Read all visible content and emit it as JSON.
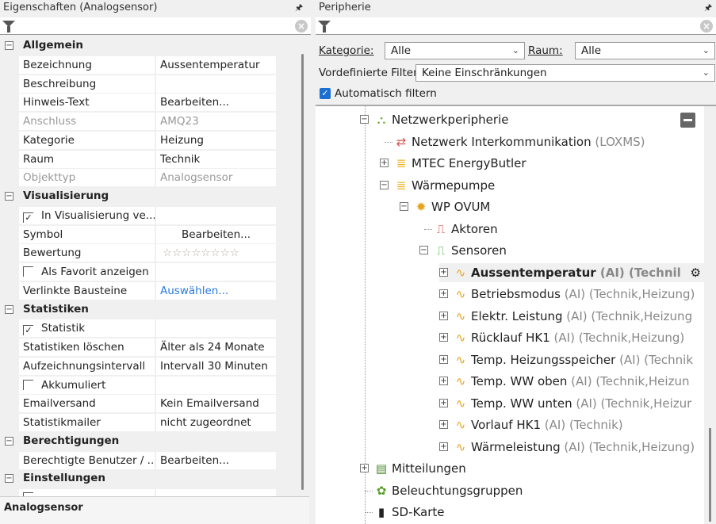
{
  "left": {
    "title": "Eigenschaften (Analogsensor)",
    "pin": "ꟷ",
    "status": "Analogsensor",
    "rows": [
      {
        "type": "section",
        "label": "Allgemein"
      },
      {
        "label": "Bezeichnung",
        "value": "Aussentemperatur"
      },
      {
        "label": "Beschreibung",
        "value": ""
      },
      {
        "label": "Hinweis-Text",
        "value": "Bearbeiten..."
      },
      {
        "label": "Anschluss",
        "value": "AMQ23",
        "disabled": true
      },
      {
        "label": "Kategorie",
        "value": "Heizung"
      },
      {
        "label": "Raum",
        "value": "Technik"
      },
      {
        "label": "Objekttyp",
        "value": "Analogsensor",
        "disabled": true
      },
      {
        "type": "section",
        "label": "Visualisierung"
      },
      {
        "type": "check",
        "label": "In Visualisierung ve...",
        "checked": true
      },
      {
        "label": "Symbol",
        "value": "Bearbeiten...",
        "center": true
      },
      {
        "label": "Bewertung",
        "value": "☆☆☆☆☆☆☆☆",
        "stars": true
      },
      {
        "type": "check",
        "label": "Als Favorit anzeigen",
        "checked": false
      },
      {
        "label": "Verlinkte Bausteine",
        "value": "Auswählen...",
        "link": true
      },
      {
        "type": "section",
        "label": "Statistiken"
      },
      {
        "type": "check",
        "label": "Statistik",
        "checked": true
      },
      {
        "label": "Statistiken löschen",
        "value": "Älter als 24 Monate"
      },
      {
        "label": "Aufzeichnungsintervall",
        "value": "Intervall 30 Minuten"
      },
      {
        "type": "check",
        "label": "Akkumuliert",
        "checked": false
      },
      {
        "label": "Emailversand",
        "value": "Kein Emailversand"
      },
      {
        "label": "Statistikmailer",
        "value": "nicht zugeordnet"
      },
      {
        "type": "section",
        "label": "Berechtigungen"
      },
      {
        "label": "Berechtigte Benutzer / ...",
        "value": "Bearbeiten..."
      },
      {
        "type": "section",
        "label": "Einstellungen"
      },
      {
        "type": "check",
        "label": "",
        "checked": false
      }
    ]
  },
  "right": {
    "title": "Peripherie",
    "kategorie_label": "Kategorie:",
    "kategorie_value": "Alle",
    "raum_label": "Raum:",
    "raum_value": "Alle",
    "filter_label": "Vordefinierte Filter",
    "filter_value": "Keine Einschränkungen",
    "auto_filter_label": "Automatisch filtern",
    "auto_filter_checked": true,
    "tree": [
      {
        "level": 0,
        "exp": "-",
        "icon": "network-icon",
        "glyph": "⛬",
        "color": "#6ab023",
        "label": "Netzwerkperipherie",
        "suffix": ""
      },
      {
        "level": 1,
        "exp": "",
        "icon": "intercom-icon",
        "glyph": "⇄",
        "color": "#d9534f",
        "label": "Netzwerk Interkommunikation",
        "suffix": "(LOXMS)"
      },
      {
        "level": 1,
        "exp": "+",
        "icon": "database-icon",
        "glyph": "≣",
        "color": "#f0b429",
        "label": "MTEC EnergyButler",
        "suffix": ""
      },
      {
        "level": 1,
        "exp": "-",
        "icon": "database-icon",
        "glyph": "≣",
        "color": "#f0b429",
        "label": "Wärmepumpe",
        "suffix": ""
      },
      {
        "level": 2,
        "exp": "-",
        "icon": "device-icon",
        "glyph": "✹",
        "color": "#e8a317",
        "label": "WP OVUM",
        "suffix": ""
      },
      {
        "level": 3,
        "exp": "",
        "icon": "actuators-icon",
        "glyph": "⎍",
        "color": "#d22",
        "label": "Aktoren",
        "suffix": ""
      },
      {
        "level": 3,
        "exp": "-",
        "icon": "sensors-icon",
        "glyph": "⎍",
        "color": "#3a3",
        "label": "Sensoren",
        "suffix": ""
      },
      {
        "level": 4,
        "exp": "+",
        "icon": "analog-sensor-icon",
        "glyph": "∿",
        "color": "#e8a317",
        "label": "Aussentemperatur",
        "suffix": "(AI) (Technil",
        "selected": true
      },
      {
        "level": 4,
        "exp": "+",
        "icon": "analog-sensor-icon",
        "glyph": "∿",
        "color": "#e8a317",
        "label": "Betriebsmodus",
        "suffix": "(AI) (Technik,Heizung)"
      },
      {
        "level": 4,
        "exp": "+",
        "icon": "analog-sensor-icon",
        "glyph": "∿",
        "color": "#e8a317",
        "label": "Elektr. Leistung",
        "suffix": "(AI) (Technik,Heizung"
      },
      {
        "level": 4,
        "exp": "+",
        "icon": "analog-sensor-icon",
        "glyph": "∿",
        "color": "#e8a317",
        "label": "Rücklauf HK1",
        "suffix": "(AI) (Technik,Heizung)"
      },
      {
        "level": 4,
        "exp": "+",
        "icon": "analog-sensor-icon",
        "glyph": "∿",
        "color": "#e8a317",
        "label": "Temp. Heizungsspeicher",
        "suffix": "(AI) (Technik"
      },
      {
        "level": 4,
        "exp": "+",
        "icon": "analog-sensor-icon",
        "glyph": "∿",
        "color": "#e8a317",
        "label": "Temp. WW oben",
        "suffix": "(AI) (Technik,Heizun"
      },
      {
        "level": 4,
        "exp": "+",
        "icon": "analog-sensor-icon",
        "glyph": "∿",
        "color": "#e8a317",
        "label": "Temp. WW unten",
        "suffix": "(AI) (Technik,Heizur"
      },
      {
        "level": 4,
        "exp": "+",
        "icon": "analog-sensor-icon",
        "glyph": "∿",
        "color": "#e8a317",
        "label": "Vorlauf HK1",
        "suffix": "(AI) (Technik)"
      },
      {
        "level": 4,
        "exp": "+",
        "icon": "analog-sensor-icon",
        "glyph": "∿",
        "color": "#e8a317",
        "label": "Wärmeleistung",
        "suffix": "(AI) (Technik,Heizung)"
      },
      {
        "level": 0,
        "exp": "+",
        "icon": "messages-icon",
        "glyph": "▤",
        "color": "#4a8a2a",
        "label": "Mitteilungen",
        "suffix": ""
      },
      {
        "level": 0,
        "exp": "",
        "icon": "lighting-groups-icon",
        "glyph": "✿",
        "color": "#5aa02c",
        "label": "Beleuchtungsgruppen",
        "suffix": ""
      },
      {
        "level": 0,
        "exp": "",
        "icon": "sd-card-icon",
        "glyph": "▮",
        "color": "#222",
        "label": "SD-Karte",
        "suffix": ""
      }
    ]
  }
}
